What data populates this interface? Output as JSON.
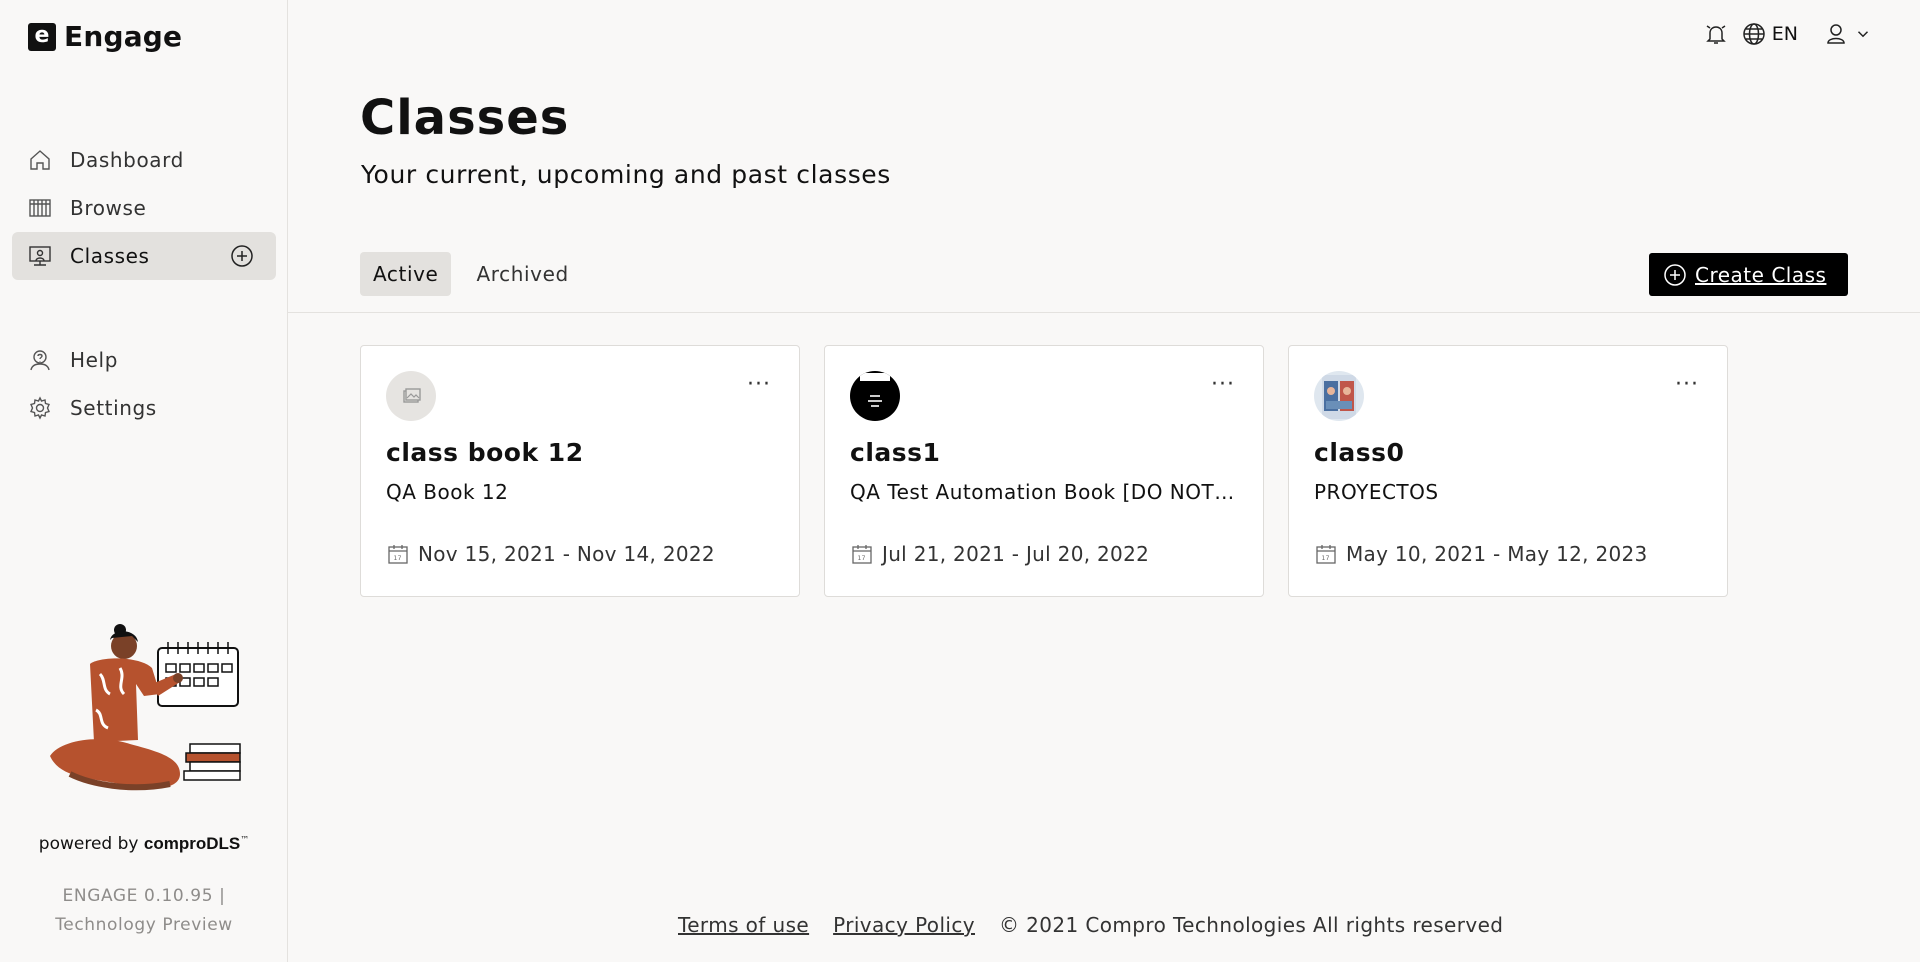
{
  "app": {
    "name": "Engage",
    "logo_letter": "e"
  },
  "sidebar": {
    "items": [
      {
        "label": "Dashboard",
        "icon": "home-icon"
      },
      {
        "label": "Browse",
        "icon": "books-icon"
      },
      {
        "label": "Classes",
        "icon": "classroom-icon",
        "active": true
      }
    ],
    "bottom_items": [
      {
        "label": "Help",
        "icon": "help-icon"
      },
      {
        "label": "Settings",
        "icon": "gear-icon"
      }
    ],
    "powered_by": "powered by",
    "powered_brand": "comproDLS",
    "trademark": "™",
    "version_line1": "ENGAGE 0.10.95 |",
    "version_line2": "Technology Preview"
  },
  "topbar": {
    "language": "EN"
  },
  "page": {
    "title": "Classes",
    "subtitle": "Your current, upcoming and past classes"
  },
  "tabs": [
    {
      "label": "Active",
      "active": true
    },
    {
      "label": "Archived",
      "active": false
    }
  ],
  "create_button": "Create Class",
  "classes": [
    {
      "name": "class book 12",
      "book": "QA Book 12",
      "dates": "Nov 15, 2021 - Nov 14, 2022"
    },
    {
      "name": "class1",
      "book": "QA Test Automation Book [DO NOT DELETE]",
      "dates": "Jul 21, 2021 - Jul 20, 2022"
    },
    {
      "name": "class0",
      "book": "PROYECTOS",
      "dates": "May 10, 2021 - May 12, 2023"
    }
  ],
  "card_more": "···",
  "footer": {
    "terms": "Terms of use",
    "privacy": "Privacy Policy",
    "copyright": "© 2021 Compro Technologies All rights reserved"
  },
  "colors": {
    "accent": "#000000",
    "active_bg": "#e3e1de",
    "page_bg": "#f9f8f7"
  }
}
